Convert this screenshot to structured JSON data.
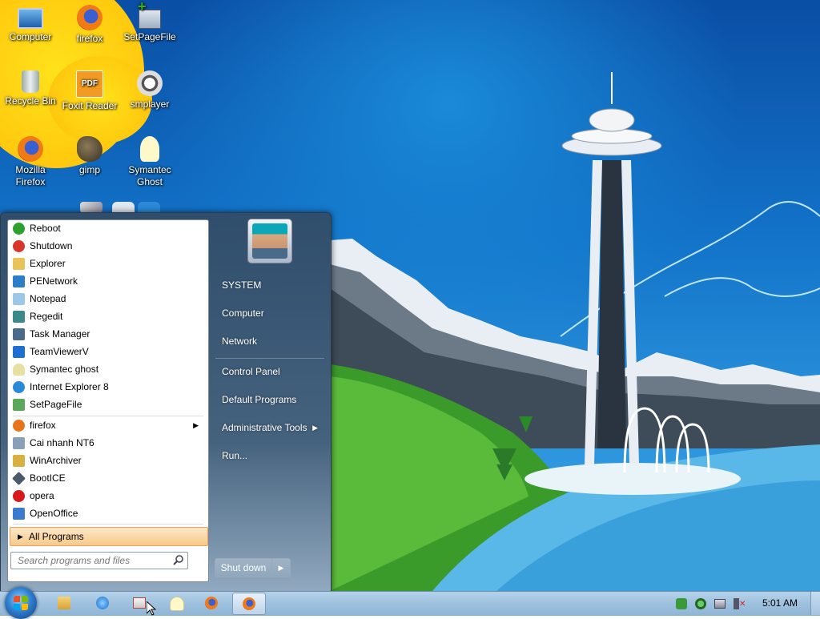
{
  "desktop": {
    "icons": [
      {
        "label": "Computer",
        "icon": "computer-icon"
      },
      {
        "label": "firefox",
        "icon": "firefox-icon"
      },
      {
        "label": "SetPageFile",
        "icon": "setpagefile-icon"
      },
      {
        "label": "Recycle Bin",
        "icon": "recycle-bin-icon"
      },
      {
        "label": "Foxit Reader",
        "icon": "pdf-icon",
        "icon_text": "PDF"
      },
      {
        "label": "smplayer",
        "icon": "smplayer-icon"
      },
      {
        "label": "Mozilla Firefox",
        "icon": "firefox-icon"
      },
      {
        "label": "gimp",
        "icon": "gimp-icon"
      },
      {
        "label": "Symantec Ghost",
        "icon": "ghost-icon"
      }
    ]
  },
  "start_menu": {
    "pinned": [
      {
        "label": "Reboot",
        "icon": "reboot-icon",
        "color": "#2ea02e"
      },
      {
        "label": "Shutdown",
        "icon": "power-icon",
        "color": "#d8362a"
      },
      {
        "label": "Explorer",
        "icon": "folder-icon",
        "color": "#e9c25a"
      },
      {
        "label": "PENetwork",
        "icon": "network-icon",
        "color": "#2a7fc8"
      },
      {
        "label": "Notepad",
        "icon": "notepad-icon",
        "color": "#9cc8e8"
      },
      {
        "label": "Regedit",
        "icon": "registry-icon",
        "color": "#3a8a8a"
      },
      {
        "label": "Task Manager",
        "icon": "task-manager-icon",
        "color": "#4a6a8a"
      },
      {
        "label": "TeamViewerV",
        "icon": "teamviewer-icon",
        "color": "#1f6fd0"
      },
      {
        "label": "Symantec ghost",
        "icon": "ghost-icon",
        "color": "#e8e0a0"
      },
      {
        "label": "Internet Explorer 8",
        "icon": "ie-icon",
        "color": "#2a8ad8"
      },
      {
        "label": "SetPageFile",
        "icon": "setpagefile-icon",
        "color": "#5aa85a"
      }
    ],
    "recent": [
      {
        "label": "firefox",
        "icon": "firefox-icon",
        "color": "#e8741a",
        "has_submenu": true
      },
      {
        "label": "Cai nhanh NT6",
        "icon": "installer-icon",
        "color": "#8aa0b8"
      },
      {
        "label": "WinArchiver",
        "icon": "archive-icon",
        "color": "#d8b040"
      },
      {
        "label": "BootICE",
        "icon": "bootice-icon",
        "color": "#4a5a6a"
      },
      {
        "label": "opera",
        "icon": "opera-icon",
        "color": "#d81a1a"
      },
      {
        "label": "OpenOffice",
        "icon": "openoffice-icon",
        "color": "#3a7ad0"
      }
    ],
    "all_programs_label": "All Programs",
    "search_placeholder": "Search programs and files",
    "right_items": [
      {
        "label": "SYSTEM"
      },
      {
        "label": "Computer"
      },
      {
        "label": "Network"
      },
      {
        "label": "Control Panel"
      },
      {
        "label": "Default Programs"
      },
      {
        "label": "Administrative Tools",
        "has_submenu": true
      },
      {
        "label": "Run..."
      }
    ],
    "shutdown_label": "Shut down"
  },
  "taskbar": {
    "pinned": [
      {
        "icon": "explorer-icon"
      },
      {
        "icon": "ie-icon"
      },
      {
        "icon": "network-tool-icon"
      },
      {
        "icon": "ghost-icon"
      },
      {
        "icon": "firefox-icon"
      },
      {
        "icon": "firefox-icon",
        "active": true
      }
    ],
    "tray": [
      {
        "icon": "security-check-icon"
      },
      {
        "icon": "media-play-icon"
      },
      {
        "icon": "network-status-icon"
      },
      {
        "icon": "volume-muted-icon"
      }
    ],
    "clock": "5:01 AM"
  }
}
